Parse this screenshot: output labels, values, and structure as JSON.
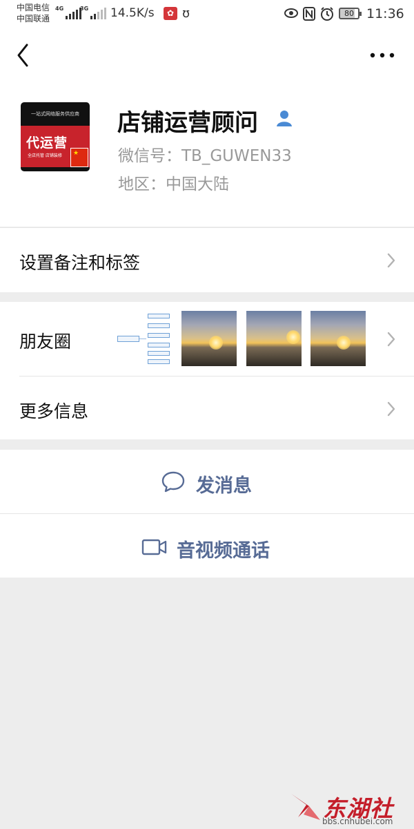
{
  "status_bar": {
    "carrier_1": "中国电信",
    "carrier_2": "中国联通",
    "network_1": "4G",
    "network_2": "3G",
    "speed": "14.5K/s",
    "battery": "80",
    "time": "11:36",
    "icons": [
      "eye-icon",
      "nfc-icon",
      "alarm-icon",
      "battery-icon"
    ]
  },
  "nav": {
    "back_icon": "chevron-left-icon",
    "more_icon": "more-dots-icon"
  },
  "profile": {
    "display_name": "店铺运营顾问",
    "wechat_id": "微信号：TB_GUWEN33",
    "region": "地区：中国大陆",
    "avatar_text": "代运营",
    "avatar_top_text": "一站式网络服务供应商",
    "avatar_sub_text": "全店托管 店铺装修"
  },
  "menu": {
    "remarks_tags": "设置备注和标签",
    "moments": "朋友圈",
    "more_info": "更多信息"
  },
  "actions": {
    "send_message": "发消息",
    "av_call": "音视频通话"
  },
  "watermark": {
    "brand": "东湖社区",
    "url": "bbs.cnhubei.com"
  },
  "colors": {
    "link": "#576b95",
    "background": "#ededed",
    "avatar_red": "#c8232c"
  }
}
